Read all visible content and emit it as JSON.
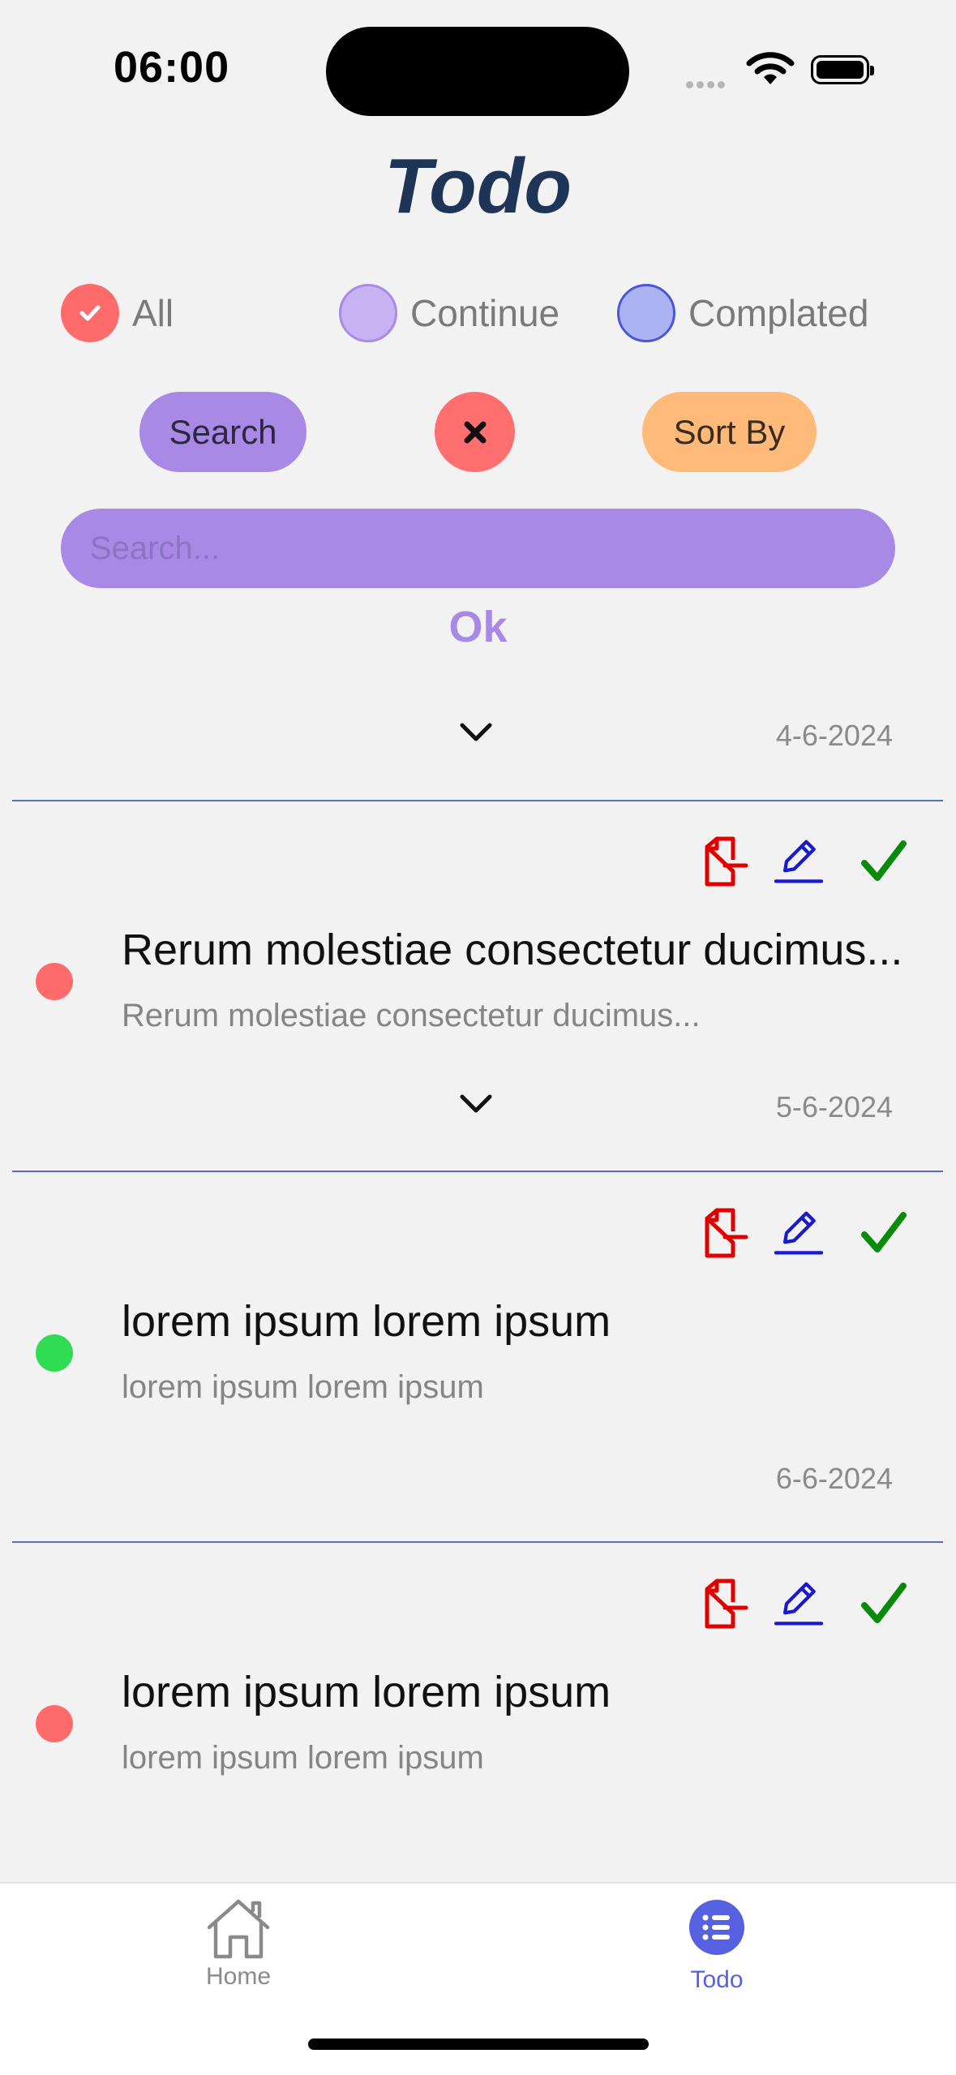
{
  "status_bar": {
    "time": "06:00"
  },
  "header": {
    "title": "Todo"
  },
  "filters": [
    {
      "label": "All",
      "selected": true
    },
    {
      "label": "Continue",
      "selected": false
    },
    {
      "label": "Complated",
      "selected": false
    }
  ],
  "toolbar": {
    "search_label": "Search",
    "sort_label": "Sort By"
  },
  "search": {
    "placeholder": "Search...",
    "ok_label": "Ok"
  },
  "first_date": "4-6-2024",
  "tasks": [
    {
      "title": "Rerum molestiae consectetur ducimus...",
      "subtitle": "Rerum molestiae consectetur ducimus...",
      "date": "5-6-2024",
      "status_color": "#ff6b6b"
    },
    {
      "title": "lorem ipsum lorem ipsum",
      "subtitle": "lorem ipsum lorem ipsum",
      "date": "6-6-2024",
      "status_color": "#2fdc52"
    },
    {
      "title": "lorem ipsum lorem ipsum",
      "subtitle": "lorem ipsum lorem ipsum",
      "status_color": "#ff6b6b"
    }
  ],
  "tabbar": {
    "home_label": "Home",
    "todo_label": "Todo",
    "active": "Todo"
  },
  "colors": {
    "accent": "#a889e6",
    "title": "#1e3558",
    "delete": "#e00000",
    "edit": "#1a1acc",
    "complete": "#0a8a0a",
    "tab_active": "#5561e0"
  }
}
